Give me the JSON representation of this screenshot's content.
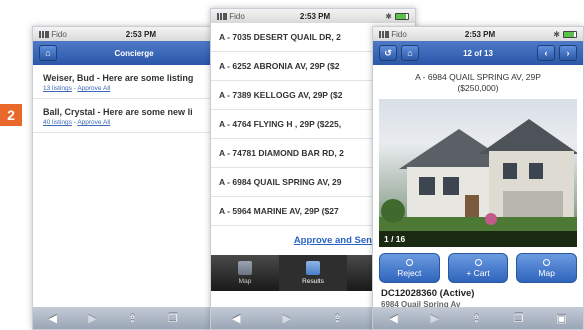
{
  "step_badge": "2",
  "phone1": {
    "status": {
      "carrier": "Fido",
      "time": "2:53 PM"
    },
    "title": "Concierge",
    "home_icon": "home-icon",
    "clients": [
      {
        "name": "Weiser, Bud - Here are some listing",
        "count_link": "13 listings",
        "sep": " - ",
        "approve_link": "Approve All"
      },
      {
        "name": "Ball, Crystal - Here are some new li",
        "count_link": "40 listings",
        "sep": " - ",
        "approve_link": "Approve All"
      }
    ]
  },
  "phone2": {
    "status": {
      "carrier": "Fido",
      "time": "2:53 PM"
    },
    "results": [
      "A - 7035 DESERT QUAIL DR, 2",
      "A - 6252 ABRONIA AV, 29P ($2",
      "A - 7389 KELLOGG AV, 29P ($2",
      "A - 4764 FLYING H , 29P ($225,",
      "A - 74781 DIAMOND BAR RD, 2",
      "A - 6984 QUAIL SPRING AV, 29",
      "A - 5964 MARINE AV, 29P ($27"
    ],
    "approve_send": "Approve and Send All",
    "tabs": [
      {
        "label": "Map"
      },
      {
        "label": "Results"
      }
    ]
  },
  "phone3": {
    "status": {
      "carrier": "Fido",
      "time": "2:53 PM"
    },
    "pager": "12 of 13",
    "listing_title": "A - 6984 QUAIL SPRING AV, 29P",
    "listing_price": "($250,000)",
    "photo_counter": "1 / 16",
    "actions": [
      {
        "label": "Reject"
      },
      {
        "label": "+ Cart"
      },
      {
        "label": "Map"
      }
    ],
    "mls": "DC12028360 (Active)",
    "address": "6984 Quail Spring Av"
  },
  "colors": {
    "header": "#2a57a8",
    "accent": "#e8692a",
    "link": "#3d68b5"
  }
}
